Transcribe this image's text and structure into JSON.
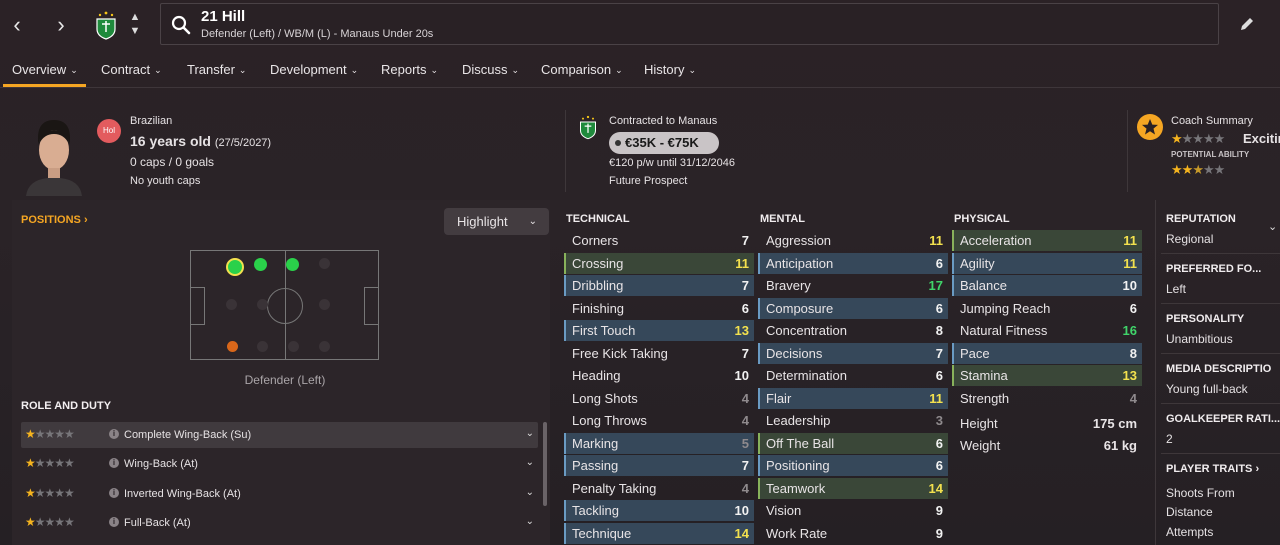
{
  "header": {
    "name": "21 Hill",
    "subtitle": "Defender (Left) / WB/M (L) - Manaus Under 20s"
  },
  "tabs": [
    {
      "label": "Overview"
    },
    {
      "label": "Contract"
    },
    {
      "label": "Transfer"
    },
    {
      "label": "Development"
    },
    {
      "label": "Reports"
    },
    {
      "label": "Discuss"
    },
    {
      "label": "Comparison"
    },
    {
      "label": "History"
    }
  ],
  "profile": {
    "nationality_badge": "Hol",
    "nationality": "Brazilian",
    "age": "16 years old",
    "dob": "(27/5/2027)",
    "caps": "0 caps / 0 goals",
    "youth_caps": "No youth caps"
  },
  "contract": {
    "club": "Contracted to Manaus",
    "value": "€35K - €75K",
    "wage": "€120 p/w until 31/12/2046",
    "status": "Future Prospect"
  },
  "coach": {
    "title": "Coach Summary",
    "rating_word": "Excitin",
    "potential_label": "POTENTIAL ABILITY",
    "current_ability_stars": 1,
    "potential_ability_stars": 2.5
  },
  "positions": {
    "title": "POSITIONS",
    "highlight_label": "Highlight",
    "caption": "Defender (Left)"
  },
  "roles": {
    "title": "ROLE AND DUTY",
    "items": [
      {
        "label": "Complete Wing-Back (Su)",
        "stars": 1
      },
      {
        "label": "Wing-Back (At)",
        "stars": 1
      },
      {
        "label": "Inverted Wing-Back (At)",
        "stars": 1
      },
      {
        "label": "Full-Back (At)",
        "stars": 1
      }
    ]
  },
  "technical": {
    "title": "TECHNICAL",
    "rows": [
      {
        "label": "Corners",
        "value": "7"
      },
      {
        "label": "Crossing",
        "value": "11"
      },
      {
        "label": "Dribbling",
        "value": "7"
      },
      {
        "label": "Finishing",
        "value": "6"
      },
      {
        "label": "First Touch",
        "value": "13"
      },
      {
        "label": "Free Kick Taking",
        "value": "7"
      },
      {
        "label": "Heading",
        "value": "10"
      },
      {
        "label": "Long Shots",
        "value": "4"
      },
      {
        "label": "Long Throws",
        "value": "4"
      },
      {
        "label": "Marking",
        "value": "5"
      },
      {
        "label": "Passing",
        "value": "7"
      },
      {
        "label": "Penalty Taking",
        "value": "4"
      },
      {
        "label": "Tackling",
        "value": "10"
      },
      {
        "label": "Technique",
        "value": "14"
      }
    ]
  },
  "mental": {
    "title": "MENTAL",
    "rows": [
      {
        "label": "Aggression",
        "value": "11"
      },
      {
        "label": "Anticipation",
        "value": "6"
      },
      {
        "label": "Bravery",
        "value": "17"
      },
      {
        "label": "Composure",
        "value": "6"
      },
      {
        "label": "Concentration",
        "value": "8"
      },
      {
        "label": "Decisions",
        "value": "7"
      },
      {
        "label": "Determination",
        "value": "6"
      },
      {
        "label": "Flair",
        "value": "11"
      },
      {
        "label": "Leadership",
        "value": "3"
      },
      {
        "label": "Off The Ball",
        "value": "6"
      },
      {
        "label": "Positioning",
        "value": "6"
      },
      {
        "label": "Teamwork",
        "value": "14"
      },
      {
        "label": "Vision",
        "value": "9"
      },
      {
        "label": "Work Rate",
        "value": "9"
      }
    ]
  },
  "physical": {
    "title": "PHYSICAL",
    "rows": [
      {
        "label": "Acceleration",
        "value": "11"
      },
      {
        "label": "Agility",
        "value": "11"
      },
      {
        "label": "Balance",
        "value": "10"
      },
      {
        "label": "Jumping Reach",
        "value": "6"
      },
      {
        "label": "Natural Fitness",
        "value": "16"
      },
      {
        "label": "Pace",
        "value": "8"
      },
      {
        "label": "Stamina",
        "value": "13"
      },
      {
        "label": "Strength",
        "value": "4"
      }
    ],
    "height_label": "Height",
    "height": "175 cm",
    "weight_label": "Weight",
    "weight": "61 kg"
  },
  "details": {
    "reputation_title": "REPUTATION",
    "reputation": "Regional",
    "foot_title": "PREFERRED FO...",
    "foot": "Left",
    "personality_title": "PERSONALITY",
    "personality": "Unambitious",
    "media_title": "MEDIA DESCRIPTIO",
    "media": "Young full-back",
    "gk_title": "GOALKEEPER RATI...",
    "gk": "2",
    "traits_title": "PLAYER TRAITS",
    "traits_1": "Shoots From",
    "traits_2": "Distance",
    "traits_3": "Attempts"
  },
  "colors": {
    "accent": "#f5a623",
    "attr_yellow": "#f3e14e",
    "attr_green": "#40d46a",
    "attr_grey": "#8f8a8d"
  }
}
